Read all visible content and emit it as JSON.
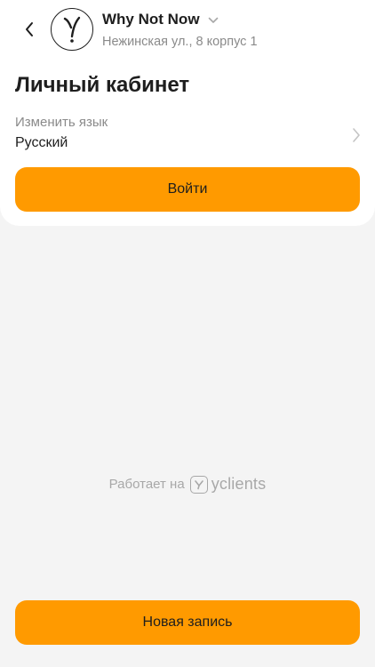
{
  "header": {
    "company_name": "Why Not Now",
    "company_address": "Нежинская ул., 8 корпус 1",
    "avatar_glyph": "Y",
    "icons": {
      "back": "chevron-left-icon",
      "dropdown": "chevron-down-icon",
      "avatar": "company-logo-icon"
    }
  },
  "main": {
    "title": "Личный кабинет",
    "language": {
      "label": "Изменить язык",
      "value": "Русский",
      "icon": "chevron-right-icon"
    },
    "login_label": "Войти"
  },
  "footer": {
    "powered_by": "Работает на",
    "brand": "yclients",
    "new_booking_label": "Новая запись"
  },
  "colors": {
    "accent": "#ff9a00",
    "background": "#f4f4f4",
    "card": "#ffffff",
    "text_primary": "#1e1e1e",
    "text_secondary": "#8a8a8a",
    "powered_text": "#a8a8a8"
  }
}
